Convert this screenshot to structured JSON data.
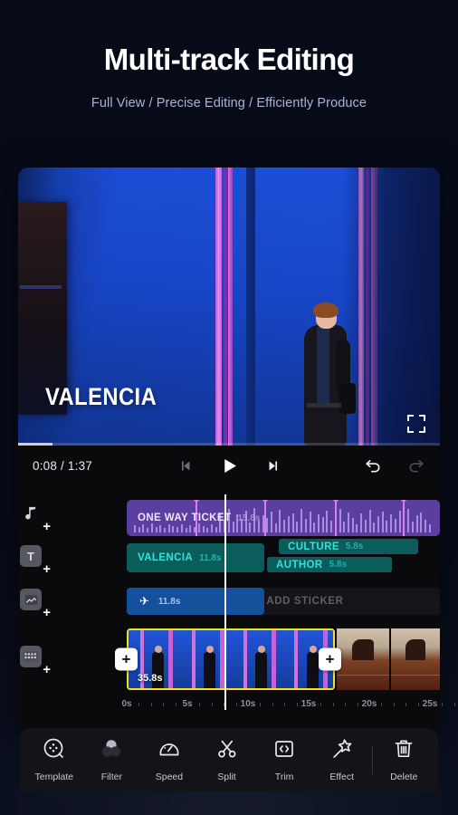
{
  "hero": {
    "title": "Multi-track Editing",
    "subtitle": "Full View / Precise Editing / Efficiently Produce"
  },
  "preview": {
    "caption_text": "VALENCIA",
    "fullscreen_icon": "fullscreen-icon",
    "progress_percent": 8.2
  },
  "controls": {
    "current_time": "0:08",
    "separator": "/",
    "total_time": "1:37",
    "time_display": "0:08 / 1:37",
    "prev_icon": "skip-previous-icon",
    "play_icon": "play-icon",
    "next_icon": "skip-next-icon",
    "undo_icon": "undo-icon",
    "redo_icon": "redo-icon"
  },
  "timeline": {
    "tracks": [
      {
        "type": "audio",
        "head_icon": "music-note-add-icon",
        "clips": [
          {
            "label": "ONE WAY TICKET",
            "duration": "15.8s",
            "color": "#5b3fa0"
          }
        ]
      },
      {
        "type": "text",
        "head_icon": "text-add-icon",
        "clips": [
          {
            "label": "VALENCIA",
            "duration": "11.8s",
            "color": "#0b5d5b"
          },
          {
            "label": "CULTURE",
            "duration": "5.8s",
            "color": "#0b5d5b"
          },
          {
            "label": "AUTHOR",
            "duration": "5.8s",
            "color": "#0b5d5b"
          }
        ]
      },
      {
        "type": "sticker",
        "head_icon": "sticker-add-icon",
        "placeholder": "TAP TO ADD STICKER",
        "clips": [
          {
            "label": "✈",
            "duration": "11.8s",
            "color": "#14509c"
          }
        ]
      },
      {
        "type": "video",
        "head_icon": "film-add-icon",
        "clips": [
          {
            "label": "",
            "duration": "35.8s",
            "selected": true
          }
        ],
        "add_left_label": "+",
        "add_right_label": "+"
      }
    ],
    "ruler_labels": [
      "0s",
      "5s",
      "10s",
      "15s",
      "20s",
      "25s"
    ],
    "playhead_time": "0:08"
  },
  "toolbar": {
    "items": [
      {
        "label": "Template",
        "icon": "template-icon"
      },
      {
        "label": "Filter",
        "icon": "filter-icon"
      },
      {
        "label": "Speed",
        "icon": "speed-icon"
      },
      {
        "label": "Split",
        "icon": "split-scissors-icon"
      },
      {
        "label": "Trim",
        "icon": "trim-icon"
      },
      {
        "label": "Effect",
        "icon": "effect-wand-icon"
      },
      {
        "label": "Delete",
        "icon": "delete-trash-icon"
      }
    ]
  },
  "colors": {
    "page_bg": "#070b18",
    "audio_clip": "#5b3fa0",
    "text_clip": "#0b5d5b",
    "text_clip_label": "#35e0d8",
    "sticker_clip": "#14509c",
    "selection": "#f5e216",
    "subtitle": "#a8b4d8"
  }
}
